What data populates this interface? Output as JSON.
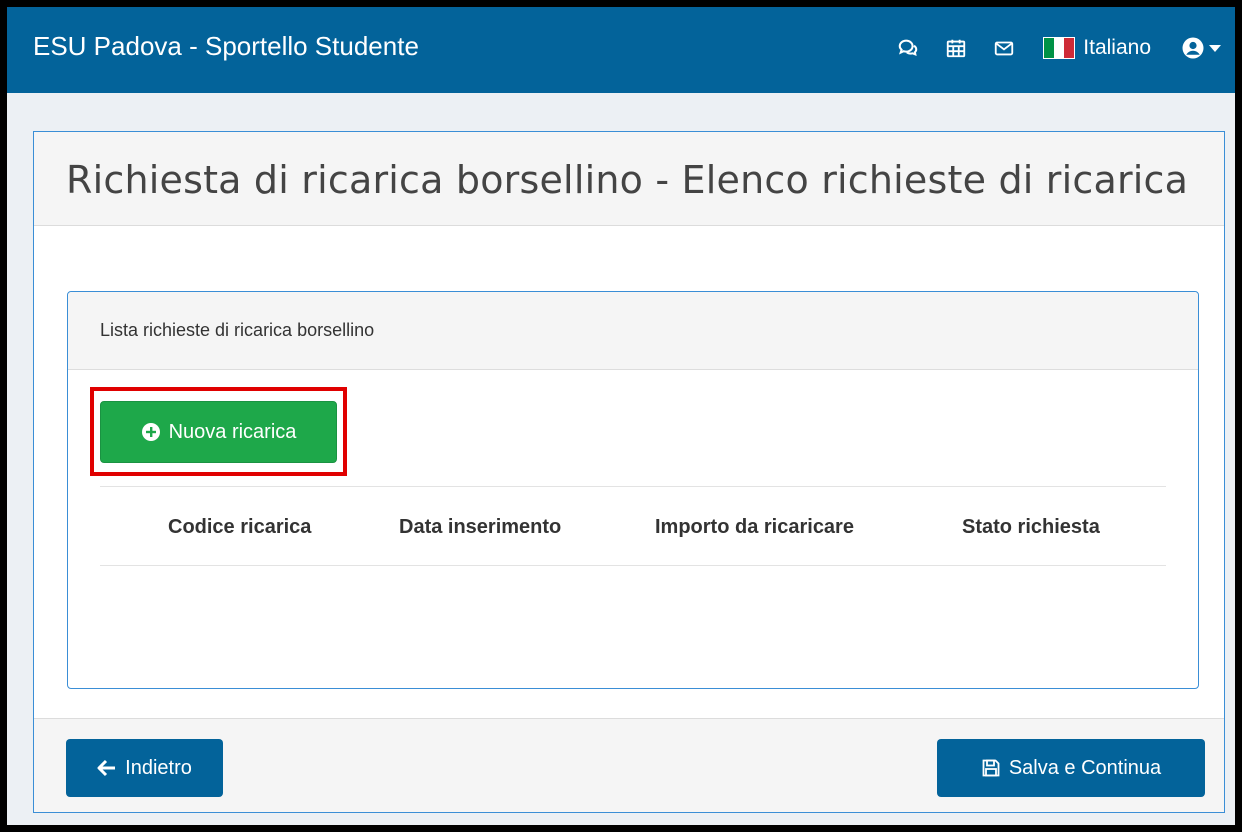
{
  "navbar": {
    "brand": "ESU Padova - Sportello Studente",
    "language": "Italiano",
    "icons": [
      "chat-icon",
      "calendar-icon",
      "mail-icon",
      "italy-flag-icon",
      "user-icon"
    ]
  },
  "page": {
    "title": "Richiesta di ricarica borsellino - Elenco richieste di ricarica"
  },
  "list_panel": {
    "title": "Lista richieste di ricarica borsellino",
    "new_button_label": "Nuova ricarica",
    "columns": [
      "Codice ricarica",
      "Data inserimento",
      "Importo da ricaricare",
      "Stato richiesta"
    ],
    "rows": []
  },
  "footer": {
    "back_label": "Indietro",
    "save_label": "Salva e Continua"
  },
  "colors": {
    "primary": "#03639a",
    "success": "#1ea84a",
    "highlight": "#e00000",
    "panel_border": "#3a8ed6"
  }
}
